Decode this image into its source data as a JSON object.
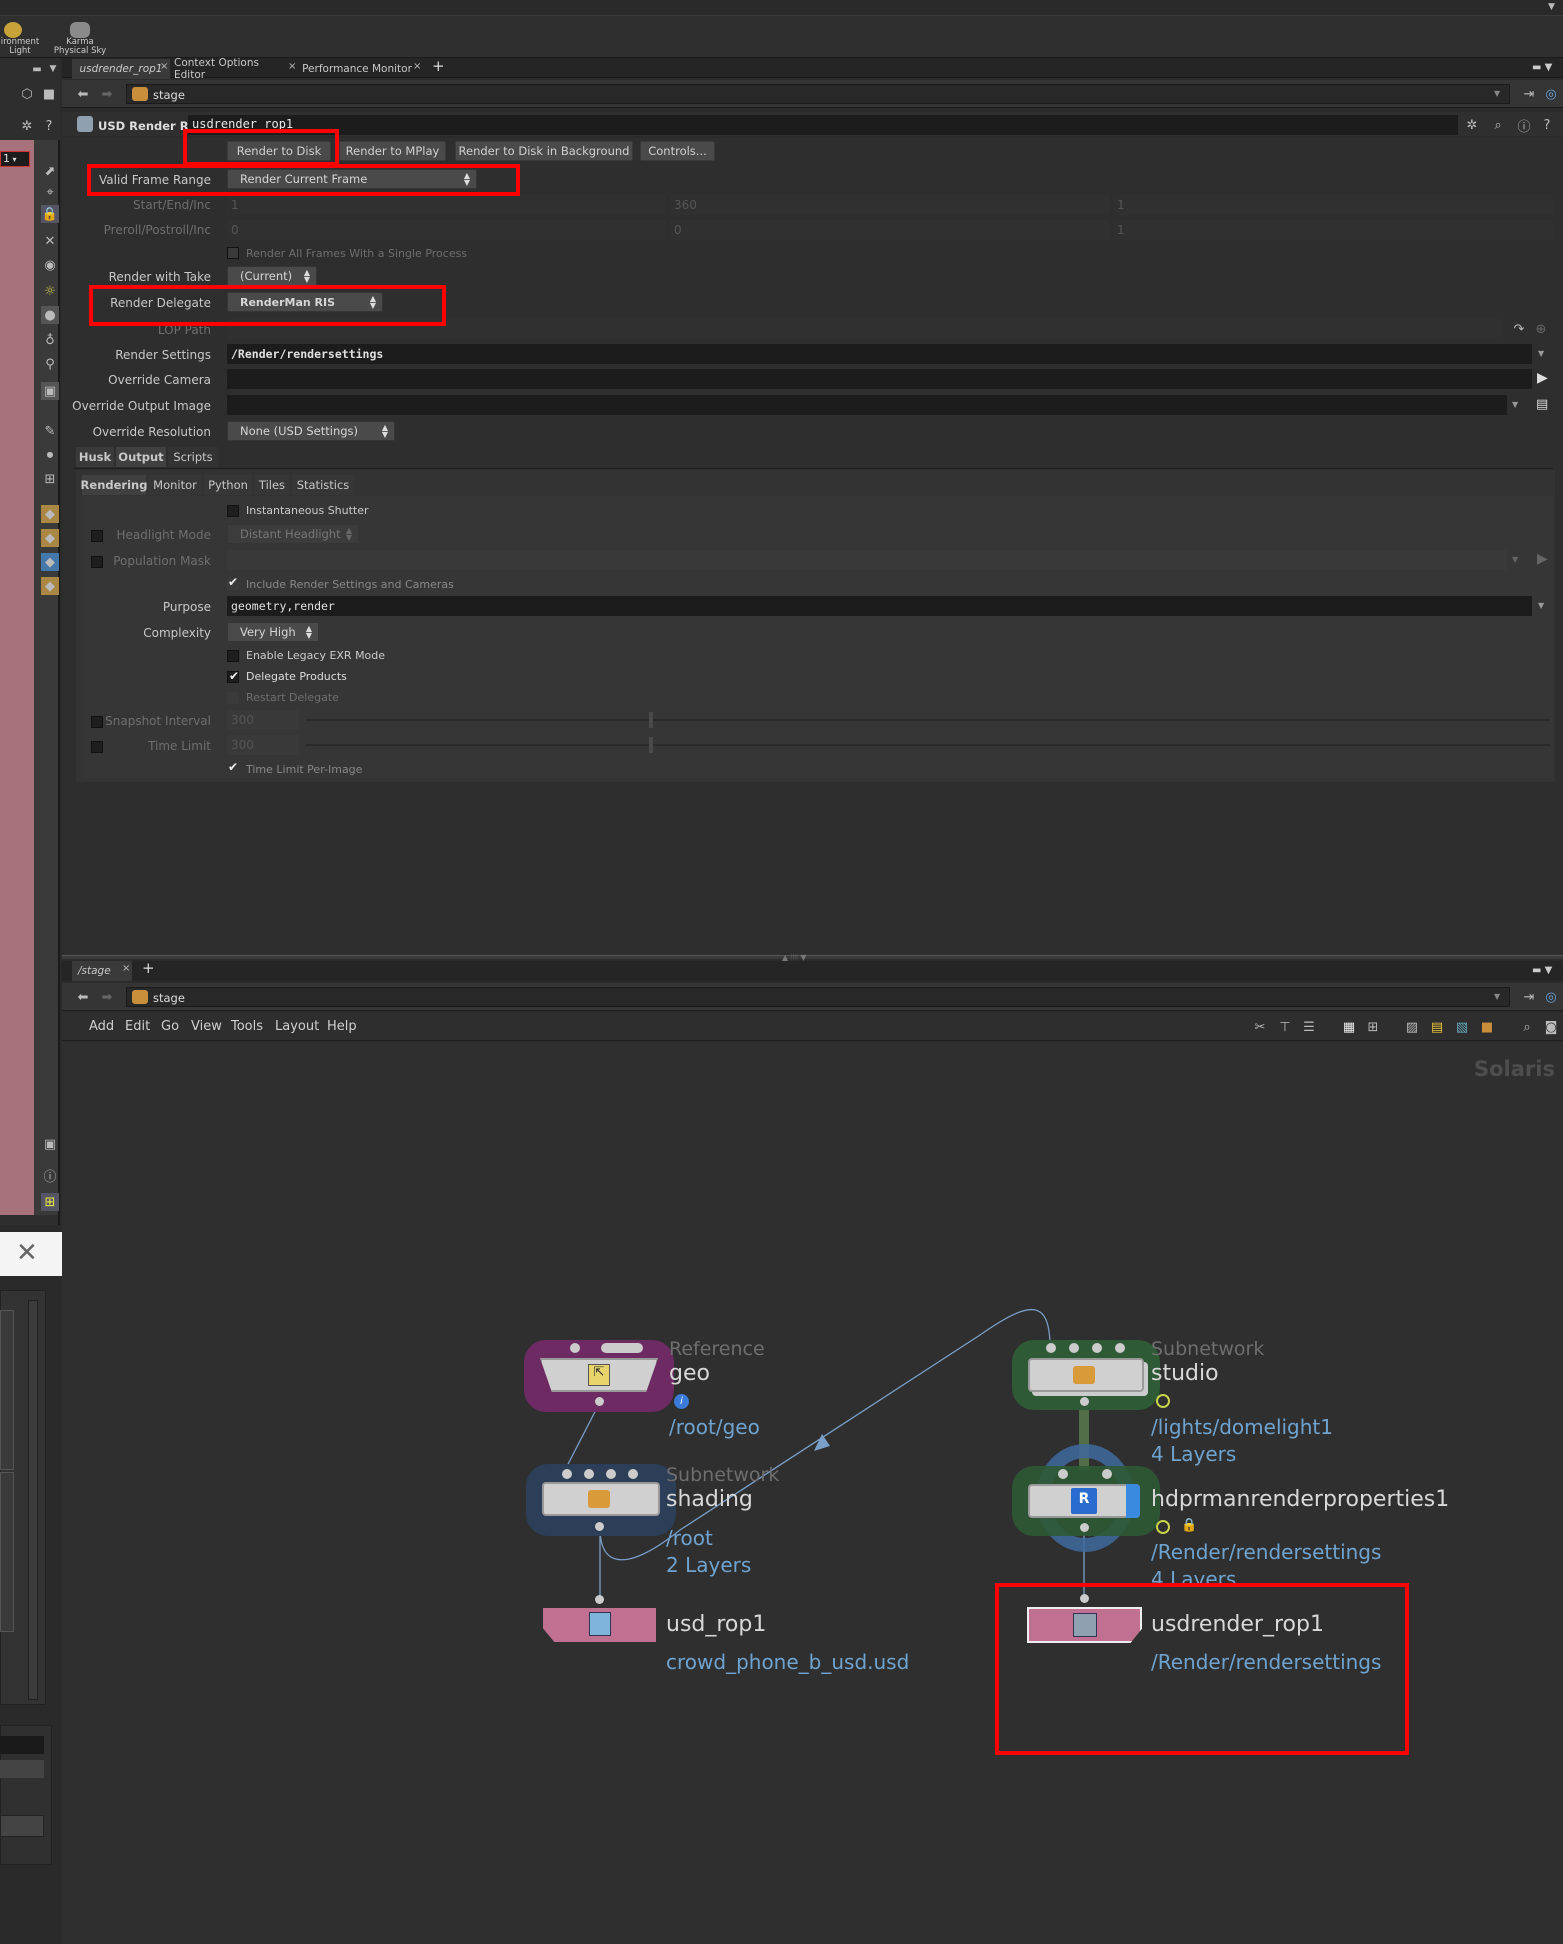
{
  "shelf": {
    "tool1_line1": "ironment",
    "tool1_line2": "Light",
    "tool2_line1": "Karma",
    "tool2_line2": "Physical Sky"
  },
  "pane_tabs": {
    "tab1": "usdrender_rop1",
    "tab2": "Context Options Editor",
    "tab3": "Performance Monitor",
    "add": "+"
  },
  "path_bar": {
    "label": "stage"
  },
  "left_field": "1",
  "node_header": {
    "type": "USD Render ROP",
    "name": "usdrender_rop1"
  },
  "render_buttons": {
    "render_to_disk": "Render to Disk",
    "render_to_mplay": "Render to MPlay",
    "render_bg": "Render to Disk in Background",
    "controls": "Controls..."
  },
  "params": {
    "valid_frame_range": {
      "label": "Valid Frame Range",
      "value": "Render Current Frame"
    },
    "start_end_inc": {
      "label": "Start/End/Inc",
      "v1": "1",
      "v2": "360",
      "v3": "1"
    },
    "preroll": {
      "label": "Preroll/Postroll/Inc",
      "v1": "0",
      "v2": "0",
      "v3": "1"
    },
    "single_process": "Render All Frames With a Single Process",
    "render_with_take": {
      "label": "Render with Take",
      "value": "(Current)"
    },
    "render_delegate": {
      "label": "Render Delegate",
      "value": "RenderMan RIS"
    },
    "lop_path": {
      "label": "LOP Path",
      "value": ""
    },
    "render_settings": {
      "label": "Render Settings",
      "value": "/Render/rendersettings"
    },
    "override_camera": {
      "label": "Override Camera",
      "value": ""
    },
    "override_output": {
      "label": "Override Output Image",
      "value": ""
    },
    "override_resolution": {
      "label": "Override Resolution",
      "value": "None (USD Settings)"
    }
  },
  "tabs1": [
    "Husk",
    "Output",
    "Scripts"
  ],
  "tabs2": [
    "Rendering",
    "Monitor",
    "Python",
    "Tiles",
    "Statistics"
  ],
  "rendering": {
    "inst_shutter": "Instantaneous Shutter",
    "headlight": {
      "label": "Headlight Mode",
      "value": "Distant Headlight"
    },
    "population": {
      "label": "Population Mask",
      "value": ""
    },
    "include_rs": "Include Render Settings and Cameras",
    "purpose": {
      "label": "Purpose",
      "value": "geometry,render"
    },
    "complexity": {
      "label": "Complexity",
      "value": "Very High"
    },
    "legacy_exr": "Enable Legacy EXR Mode",
    "delegate_products": "Delegate Products",
    "restart_delegate": "Restart Delegate",
    "snapshot": {
      "label": "Snapshot Interval",
      "value": "300"
    },
    "time_limit": {
      "label": "Time Limit",
      "value": "300"
    },
    "time_limit_per_image": "Time Limit Per-Image"
  },
  "network": {
    "tab": "/stage",
    "add": "+",
    "path": "stage",
    "menu": [
      "Add",
      "Edit",
      "Go",
      "View",
      "Tools",
      "Layout",
      "Help"
    ],
    "context_label": "Solaris",
    "nodes": {
      "geo": {
        "type": "Reference",
        "name": "geo",
        "path": "/root/geo"
      },
      "shading": {
        "type": "Subnetwork",
        "name": "shading",
        "path": "/root",
        "layers": "2 Layers"
      },
      "usd_rop1": {
        "name": "usd_rop1",
        "path": "crowd_phone_b_usd.usd"
      },
      "studio": {
        "type": "Subnetwork",
        "name": "studio",
        "path": "/lights/domelight1",
        "layers": "4 Layers"
      },
      "hdprman": {
        "name": "hdprmanrenderproperties1",
        "path": "/Render/rendersettings",
        "layers": "4 Layers"
      },
      "usdrender": {
        "name": "usdrender_rop1",
        "path": "/Render/rendersettings"
      }
    }
  },
  "colors": {
    "highlight": "#ff0000",
    "node_path": "#6fa3cf",
    "geo_node": "#7a2a6e",
    "rop_node": "#c07090",
    "subnet_green": "#2e5a35",
    "subnet_blue": "#2c3e55"
  }
}
